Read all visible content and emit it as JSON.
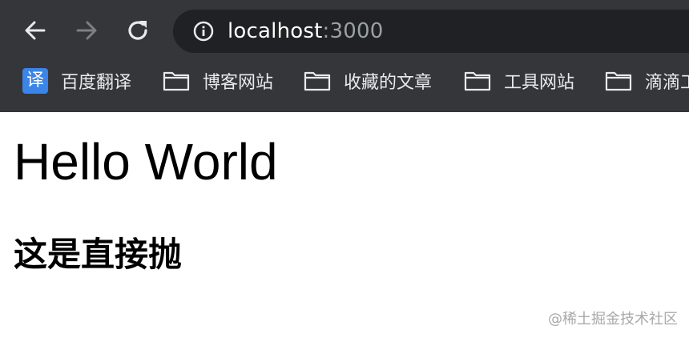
{
  "browser": {
    "url_host": "localhost",
    "url_port": ":3000"
  },
  "bookmarks": [
    {
      "label": "百度翻译",
      "icon": "translate-icon",
      "badge": "译"
    },
    {
      "label": "博客网站",
      "icon": "folder-icon"
    },
    {
      "label": "收藏的文章",
      "icon": "folder-icon"
    },
    {
      "label": "工具网站",
      "icon": "folder-icon"
    },
    {
      "label": "滴滴工",
      "icon": "folder-icon"
    }
  ],
  "page": {
    "heading": "Hello World",
    "subheading": "这是直接抛"
  },
  "watermark": "@稀土掘金技术社区",
  "colors": {
    "chrome_bg": "#35363a",
    "omnibox_bg": "#202124",
    "accent_blue": "#3b84e8"
  }
}
